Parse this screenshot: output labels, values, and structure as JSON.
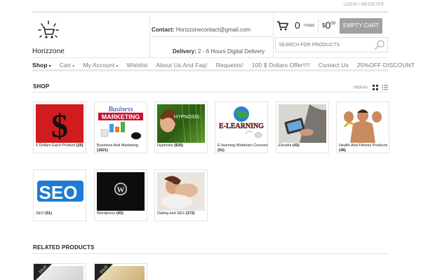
{
  "top_links": {
    "login": "LOGIN",
    "separator": " / ",
    "register": "REGISTER"
  },
  "logo": {
    "text": "Horizzone"
  },
  "contact": {
    "label": "Contact:",
    "value": "Horizzonecontact@gmail.com"
  },
  "delivery": {
    "label": "Delivery:",
    "value": "2 - 6 Hours Digital Delivery"
  },
  "cart": {
    "count": "0",
    "items_label": "ITEMS",
    "currency": "$",
    "price": "0",
    "price_cents": "00",
    "empty_label": "EMPTY CART"
  },
  "search": {
    "placeholder": "SEARCH FOR PRODUCTS"
  },
  "nav": [
    {
      "label": "Shop",
      "dropdown": true
    },
    {
      "label": "Cart",
      "dropdown": true
    },
    {
      "label": "My Account",
      "dropdown": true
    },
    {
      "label": "Wishlist"
    },
    {
      "label": "About Us And Faq!"
    },
    {
      "label": "Requests!"
    },
    {
      "label": "100 $ Dollars Offer!!!!"
    },
    {
      "label": "Contact Us"
    },
    {
      "label": "25%OFF DISCOUNT"
    }
  ],
  "shop": {
    "title": "SHOP",
    "view_as": "VIEW AS:"
  },
  "categories": [
    {
      "name": "5 Dollars Each Product",
      "count": "(25)"
    },
    {
      "name": "Business And Marketing",
      "count": "(1821)"
    },
    {
      "name": "Hypnosis",
      "count": "($35)"
    },
    {
      "name": "E-learning Webinars Courses",
      "count": "(51)"
    },
    {
      "name": "Ebooks",
      "count": "(42)"
    },
    {
      "name": "Health And Fitness Products",
      "count": "(48)"
    },
    {
      "name": "SEO",
      "count": "(51)"
    },
    {
      "name": "Wordpress",
      "count": "(93)"
    },
    {
      "name": "Dating and SEX",
      "count": "(172)"
    }
  ],
  "thumbnail_text": {
    "five": "$",
    "business": "Business",
    "marketing": "MARKETING",
    "hypnosis": "HYPNOSIS",
    "elearning": "E-LEARNING",
    "seo": "SEO",
    "wordpress": "W"
  },
  "related": {
    "title": "RELATED PRODUCTS",
    "sale_badge": "SALE!"
  },
  "colors": {
    "empty_cart_bg": "#a0a0a0",
    "nav_active": "#222222",
    "border": "#e2e2e2"
  }
}
